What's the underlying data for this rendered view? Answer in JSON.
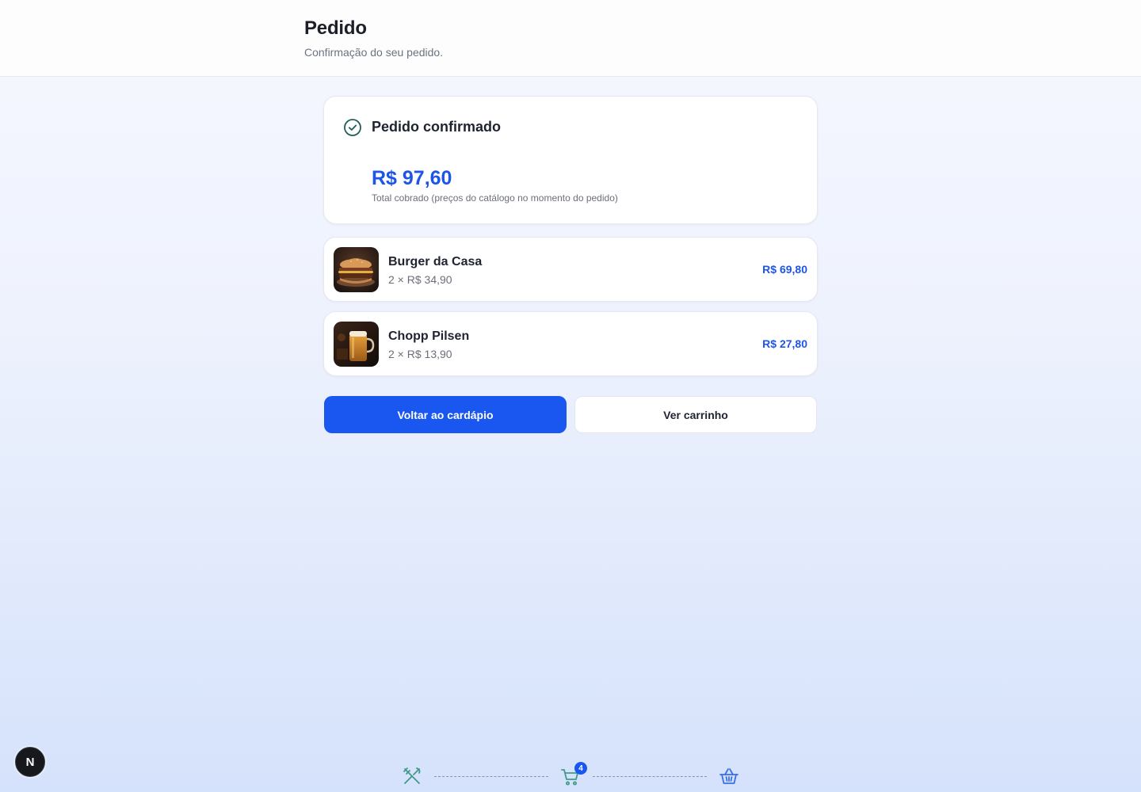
{
  "header": {
    "title": "Pedido",
    "subtitle": "Confirmação do seu pedido."
  },
  "status": {
    "icon": "check-circle-icon",
    "title": "Pedido confirmado",
    "total": "R$ 97,60",
    "total_note": "Total cobrado (preços do catálogo no momento do pedido)"
  },
  "items": [
    {
      "name": "Burger da Casa",
      "quantity": "2 × R$ 34,90",
      "subtotal": "R$ 69,80",
      "image": "burger-image"
    },
    {
      "name": "Chopp Pilsen",
      "quantity": "2 × R$ 13,90",
      "subtotal": "R$ 27,80",
      "image": "beer-image"
    }
  ],
  "actions": {
    "back_label": "Voltar ao cardápio",
    "cart_label": "Ver carrinho"
  },
  "dev_badge": {
    "letter": "N"
  },
  "bottom_nav": {
    "menu_icon": "utensils-icon",
    "cart_icon": "cart-icon",
    "cart_count": "4",
    "basket_icon": "basket-icon"
  },
  "colors": {
    "accent": "#1a56f0",
    "price": "#1d55e8",
    "check": "#1f5f5b",
    "nav_icon": "#3f9a8a"
  }
}
